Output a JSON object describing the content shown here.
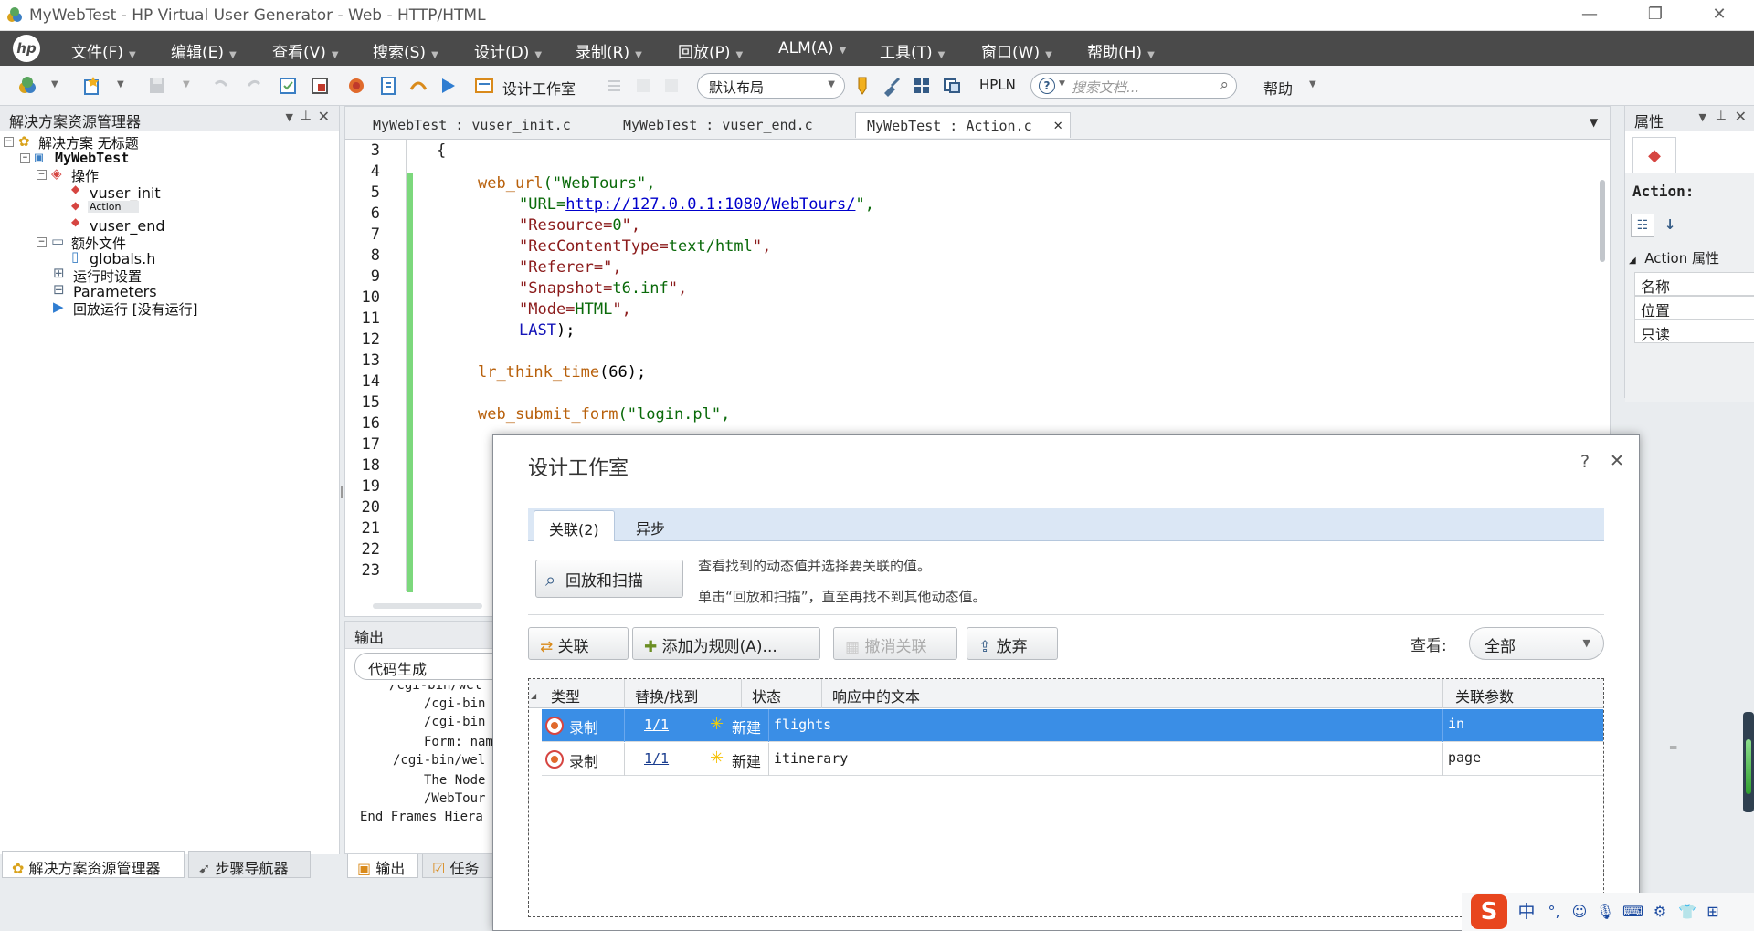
{
  "window": {
    "title": "MyWebTest - HP Virtual User Generator - Web - HTTP/HTML",
    "minimize": "—",
    "restore": "❐",
    "close": "✕"
  },
  "menu": [
    "文件(F)",
    "编辑(E)",
    "查看(V)",
    "搜索(S)",
    "设计(D)",
    "录制(R)",
    "回放(P)",
    "ALM(A)",
    "工具(T)",
    "窗口(W)",
    "帮助(H)"
  ],
  "toolbar": {
    "design_studio": "设计工作室",
    "layout": "默认布局",
    "hpln": "HPLN",
    "search_placeholder": "搜索文档...",
    "help": "帮助"
  },
  "solution_explorer": {
    "title": "解决方案资源管理器",
    "items": {
      "solution": "解决方案 无标题",
      "project": "MyWebTest",
      "actions": "操作",
      "vuser_init": "vuser_init",
      "action": "Action",
      "vuser_end": "vuser_end",
      "extra_files": "额外文件",
      "globals": "globals.h",
      "runtime_settings": "运行时设置",
      "parameters": "Parameters",
      "replay": "回放运行 [没有运行]"
    }
  },
  "bottom_tabs": {
    "solution": "解决方案资源管理器",
    "step_nav": "步骤导航器",
    "output": "输出",
    "tasks": "任务"
  },
  "editor": {
    "tabs": [
      "MyWebTest : vuser_init.c",
      "MyWebTest : vuser_end.c",
      "MyWebTest : Action.c"
    ],
    "active_tab": 2,
    "line_numbers": [
      "3",
      "4",
      "5",
      "6",
      "7",
      "8",
      "9",
      "10",
      "11",
      "12",
      "13",
      "14",
      "15",
      "16",
      "17",
      "18",
      "19",
      "20",
      "21",
      "22",
      "23"
    ],
    "code": {
      "l4_fn": "web_url",
      "l4_arg": "(\"WebTours\",",
      "l5_a": "\"URL=",
      "l5_url": "http://127.0.0.1:1080/WebTours/",
      "l5_b": "\",",
      "l6_a": "\"Resource=",
      "l6_b": "0",
      "l6_c": "\",",
      "l7_a": "\"RecContentType=",
      "l7_b": "text/html",
      "l7_c": "\",",
      "l8": "\"Referer=\",",
      "l9_a": "\"Snapshot=",
      "l9_b": "t6.inf",
      "l9_c": "\",",
      "l10_a": "\"Mode=",
      "l10_b": "HTML",
      "l10_c": "\",",
      "l11_kw": "LAST",
      "l11_b": ");",
      "l13_fn": "lr_think_time",
      "l13_arg": "(66);",
      "l15_fn": "web_submit_form",
      "l15_arg": "(\"login.pl\","
    }
  },
  "output": {
    "title": "输出",
    "selector": "代码生成",
    "lines": [
      "/cgi-bin/wel",
      "/cgi-bin",
      "/cgi-bin",
      "Form: nam",
      "/cgi-bin/wel",
      "The Node",
      "/WebTour",
      "End Frames Hiera"
    ]
  },
  "properties": {
    "title": "属性",
    "object": "Action:",
    "group": "Action 属性",
    "rows": [
      "名称",
      "位置",
      "只读"
    ]
  },
  "dialog": {
    "title": "设计工作室",
    "help": "?",
    "close": "✕",
    "tabs": [
      "关联(2)",
      "异步"
    ],
    "replay_scan": "回放和扫描",
    "hint1": "查看找到的动态值并选择要关联的值。",
    "hint2": "单击“回放和扫描”，直至再找不到其他动态值。",
    "buttons": {
      "correlate": "关联",
      "add_rule": "添加为规则(A)...",
      "undo": "撤消关联",
      "discard": "放弃"
    },
    "view_label": "查看:",
    "view_value": "全部",
    "columns": [
      "类型",
      "替换/找到",
      "状态",
      "响应中的文本",
      "关联参数"
    ],
    "rows": [
      {
        "type": "录制",
        "found": "1/1",
        "status": "新建",
        "text": "flights",
        "param": "in"
      },
      {
        "type": "录制",
        "found": "1/1",
        "status": "新建",
        "text": "itinerary",
        "param": "page"
      }
    ]
  },
  "tray": {
    "ime": "中",
    "punct": "°,"
  },
  "colors": {
    "menubar": "#4a4a4a",
    "selection": "#3a8ee6",
    "keyword": "#1515b8",
    "string": "#0a6a0a",
    "function": "#b8600b"
  }
}
